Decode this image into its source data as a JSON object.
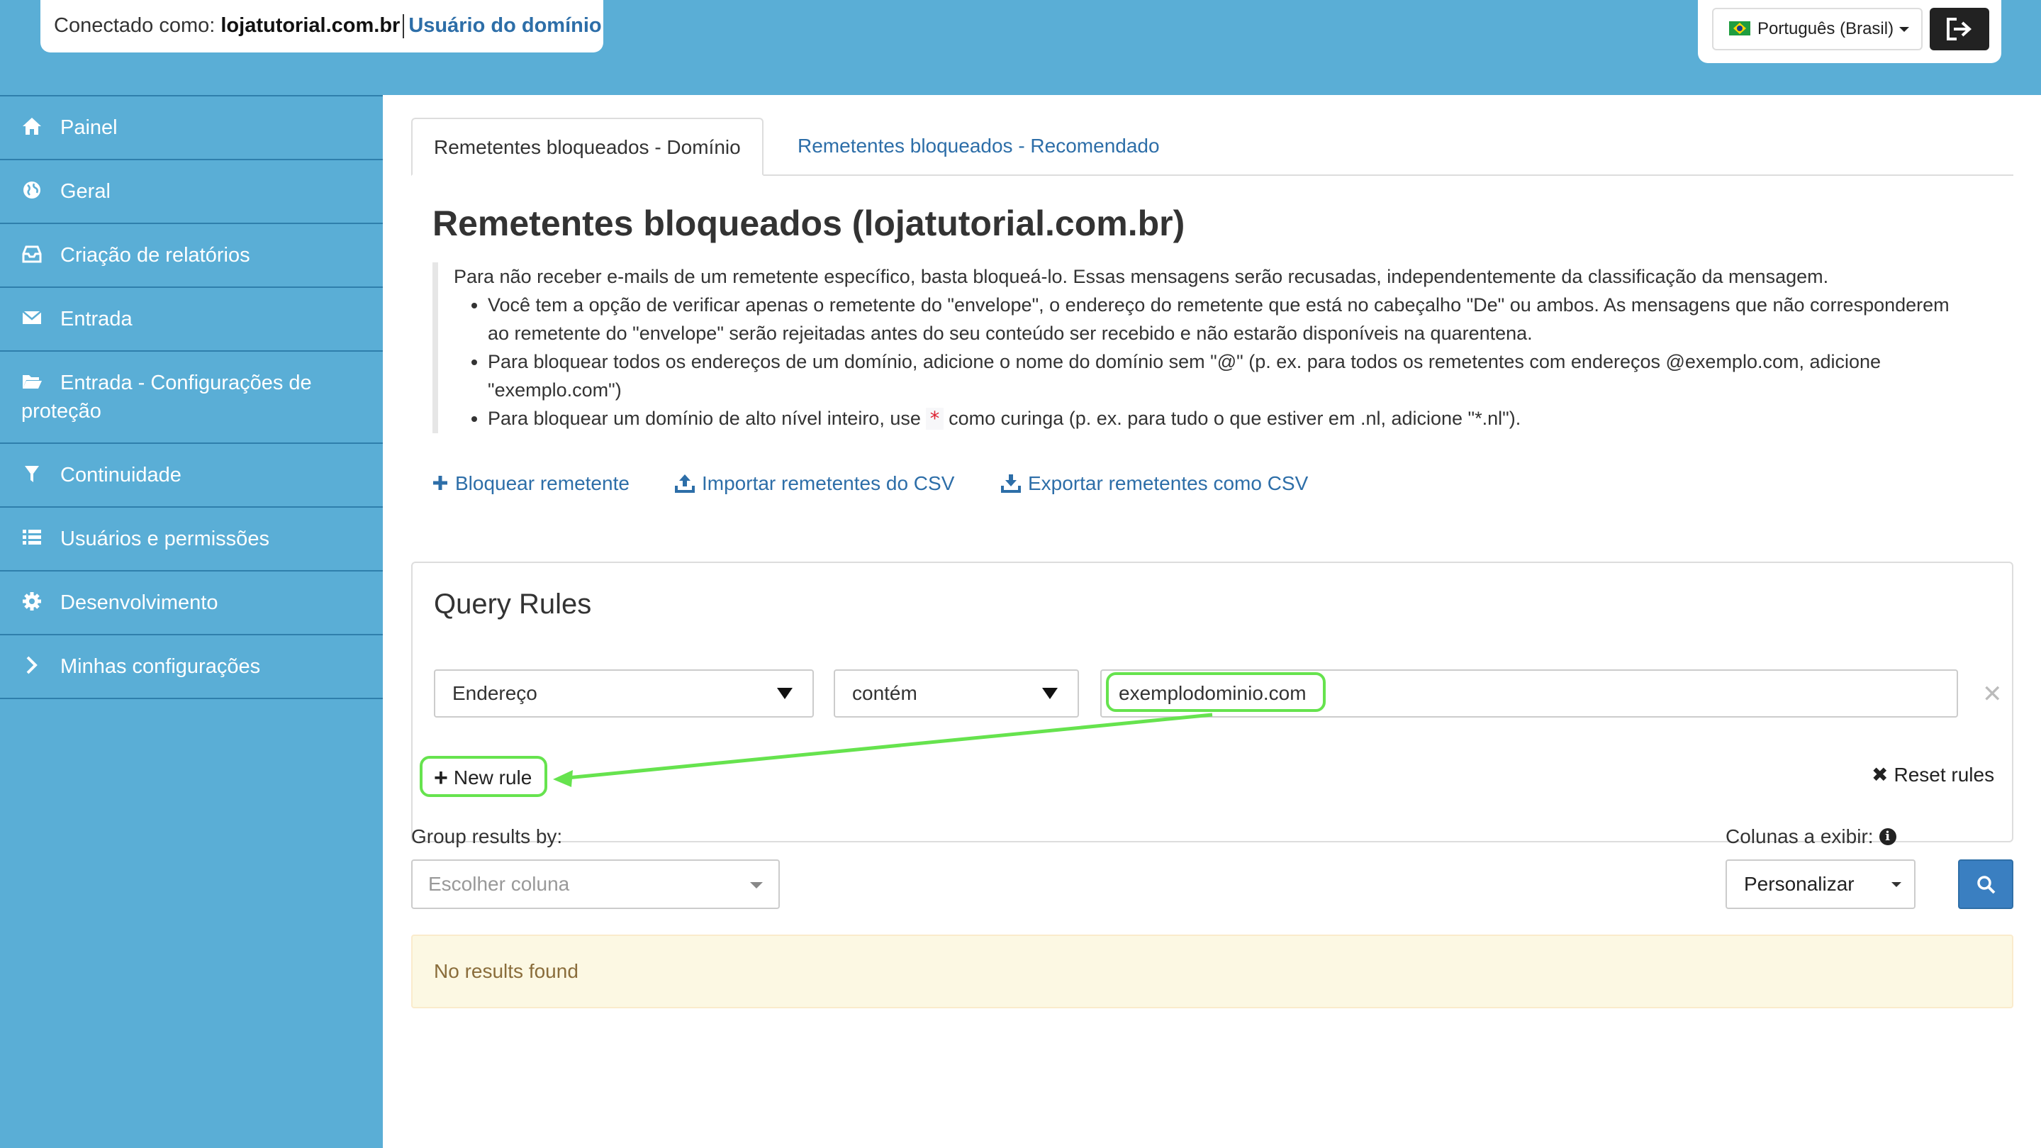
{
  "header": {
    "login_prefix": "Conectado como: ",
    "login_domain": "lojatutorial.com.br",
    "login_role": "Usuário do domínio",
    "language": "Português (Brasil)"
  },
  "sidebar": {
    "items": [
      {
        "label": "Painel",
        "icon": "home-icon"
      },
      {
        "label": "Geral",
        "icon": "globe-icon"
      },
      {
        "label": "Criação de relatórios",
        "icon": "inbox-icon"
      },
      {
        "label": "Entrada",
        "icon": "envelope-icon"
      },
      {
        "label": "Entrada - Configurações de proteção",
        "icon": "folder-open-icon"
      },
      {
        "label": "Continuidade",
        "icon": "filter-icon"
      },
      {
        "label": "Usuários e permissões",
        "icon": "list-icon"
      },
      {
        "label": "Desenvolvimento",
        "icon": "gear-icon"
      },
      {
        "label": "Minhas configurações",
        "icon": "chevron-right-icon"
      }
    ]
  },
  "tabs": {
    "active": "Remetentes bloqueados - Domínio",
    "other": "Remetentes bloqueados - Recomendado"
  },
  "page": {
    "title": "Remetentes bloqueados (lojatutorial.com.br)",
    "intro": "Para não receber e-mails de um remetente específico, basta bloqueá-lo. Essas mensagens serão recusadas, independentemente da classificação da mensagem.",
    "bullet1": "Você tem a opção de verificar apenas o remetente do \"envelope\", o endereço do remetente que está no cabeçalho \"De\" ou ambos. As mensagens que não corresponderem ao remetente do \"envelope\" serão rejeitadas antes do seu conteúdo ser recebido e não estarão disponíveis na quarentena.",
    "bullet2": "Para bloquear todos os endereços de um domínio, adicione o nome do domínio sem \"@\" (p. ex. para todos os remetentes com endereços @exemplo.com, adicione \"exemplo.com\")",
    "bullet3_pre": "Para bloquear um domínio de alto nível inteiro, use ",
    "bullet3_code": "*",
    "bullet3_post": " como curinga (p. ex. para tudo o que estiver em .nl, adicione \"*.nl\")."
  },
  "actions": {
    "block": "Bloquear remetente",
    "import": "Importar remetentes do CSV",
    "export": "Exportar remetentes como CSV"
  },
  "query": {
    "title": "Query Rules",
    "field": "Endereço",
    "operator": "contém",
    "value": "exemplodominio.com",
    "new_rule": "New rule",
    "reset_rules": "Reset rules"
  },
  "results": {
    "group_label": "Group results by:",
    "group_placeholder": "Escolher coluna",
    "columns_label": "Colunas a exibir:",
    "columns_value": "Personalizar",
    "empty": "No results found"
  },
  "colors": {
    "header_bg": "#5aaed6",
    "link": "#2d6ea8",
    "highlight": "#66e34e",
    "search_button": "#3a7fc1"
  }
}
